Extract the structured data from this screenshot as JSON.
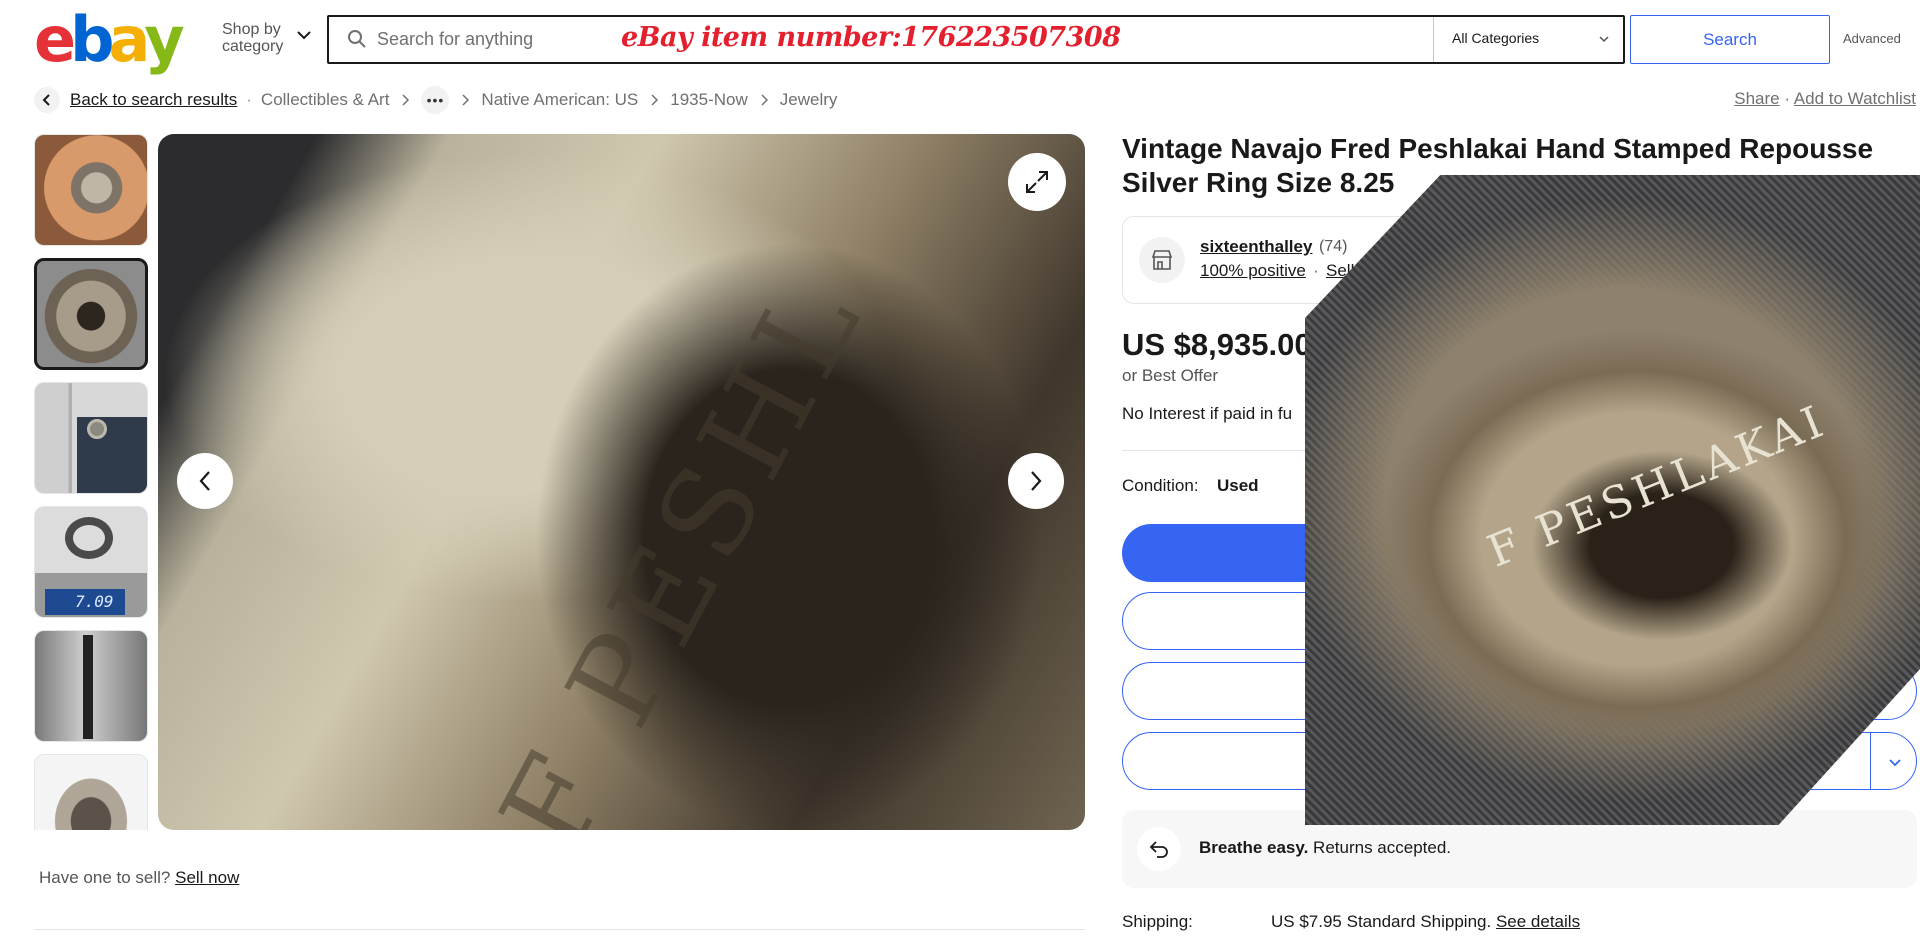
{
  "header": {
    "logo_letters": [
      "e",
      "b",
      "a",
      "y"
    ],
    "logo_colors": [
      "#e53238",
      "#0064d2",
      "#f5af02",
      "#86b817"
    ],
    "shop_by_line1": "Shop by",
    "shop_by_line2": "category",
    "search_placeholder": "Search for anything",
    "item_number_overlay": "eBay item number:176223507308",
    "category_select": "All Categories",
    "search_button": "Search",
    "advanced_link": "Advanced"
  },
  "breadcrumb": {
    "back": "Back to search results",
    "items": [
      "Collectibles & Art",
      "Native American: US",
      "1935-Now",
      "Jewelry"
    ],
    "more": "•••",
    "share": "Share",
    "watchlist": "Add to Watchlist"
  },
  "gallery": {
    "thumbnail_count": 6,
    "active_thumbnail": 2,
    "scale_readout": "7.09",
    "stamp_text": "F PESHL",
    "icons": [
      "expand-icon",
      "chevron-left-icon",
      "chevron-right-icon"
    ]
  },
  "sell": {
    "prompt": "Have one to sell?",
    "link": "Sell now"
  },
  "listing": {
    "title": "Vintage Navajo Fred Peshlakai Hand Stamped Repousse Silver Ring Size 8.25",
    "seller_name": "sixteenthalley",
    "seller_count": "(74)",
    "seller_positive": "100% positive",
    "seller_other": "Seller's o",
    "price": "US $8,935.00",
    "best_offer": "or Best Offer",
    "no_interest": "No Interest if paid in fu",
    "condition_label": "Condition:",
    "condition_value": "Used",
    "returns_bold": "Breathe easy.",
    "returns_text": "Returns accepted.",
    "shipping_label": "Shipping:",
    "shipping_value": "US $7.95 Standard Shipping.",
    "shipping_link": "See details"
  },
  "overlay_photo": {
    "engraving": "F PESHLAKAI"
  },
  "colors": {
    "accent": "#3665f3",
    "text": "#191919",
    "muted": "#707070",
    "item_number": "#e4202f"
  }
}
